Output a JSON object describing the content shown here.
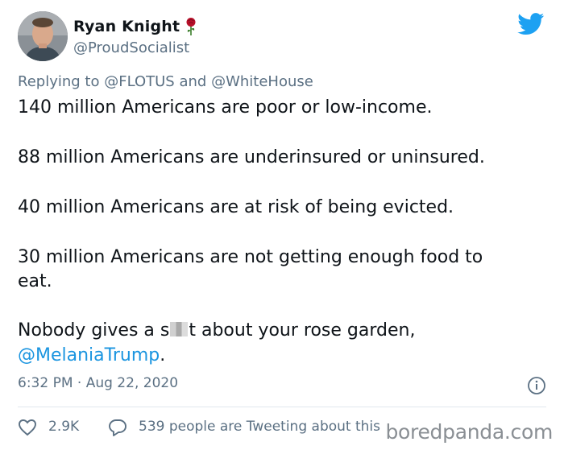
{
  "author": {
    "display_name": "Ryan Knight",
    "handle": "@ProudSocialist",
    "name_emoji": "rose-icon"
  },
  "replying": {
    "prefix": "Replying to",
    "mention_1": "@FLOTUS",
    "conjunction": "and",
    "mention_2": "@WhiteHouse"
  },
  "tweet": {
    "line_1": "140 million Americans are poor or low-income.",
    "line_2": "88 million Americans are underinsured or uninsured.",
    "line_3": "40 million Americans are at risk of being evicted.",
    "line_4a": "30 million Americans are not getting enough food to",
    "line_4b": "eat.",
    "line_5_pre": "Nobody gives a s",
    "line_5_post": "t about your rose garden,",
    "mention_link": "@MelaniaTrump",
    "end_punct": "."
  },
  "meta": {
    "timestamp": "6:32 PM · Aug 22, 2020"
  },
  "actions": {
    "like_count": "2.9K",
    "tweeting_text": "539 people are Tweeting about this"
  },
  "watermark": "boredpanda.com",
  "colors": {
    "brand_blue": "#1da1f2",
    "link_blue": "#1b95e0",
    "secondary_text": "#5b7083",
    "rose_red": "#b8102a"
  }
}
